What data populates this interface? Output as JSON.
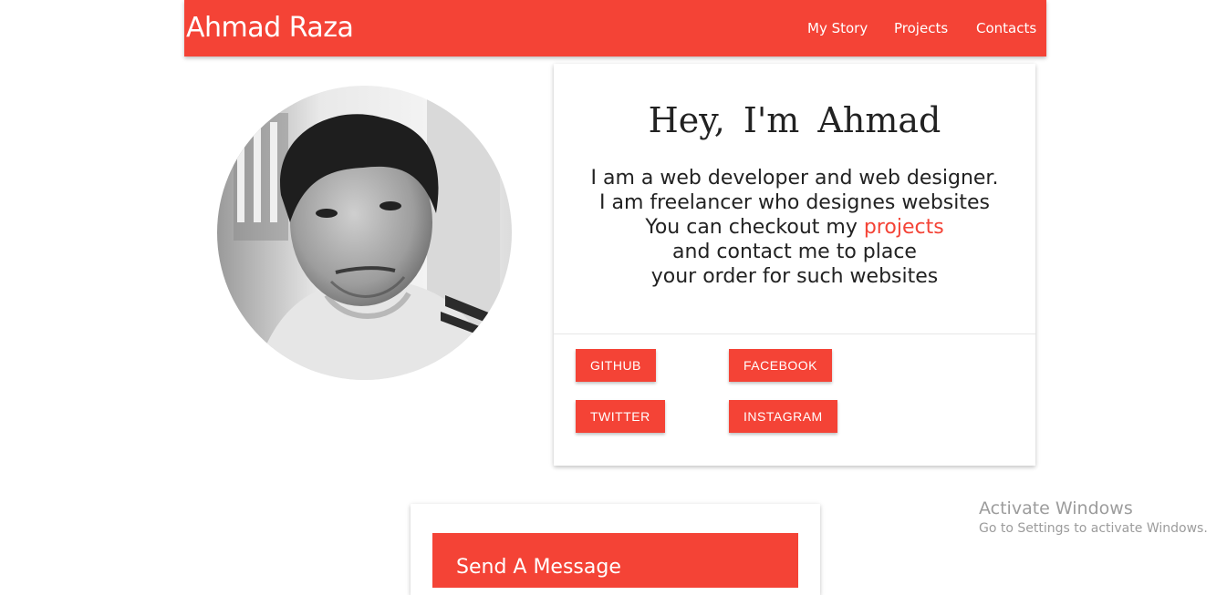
{
  "navbar": {
    "brand": "Ahmad Raza",
    "links": [
      "My Story",
      "Projects",
      "Contacts"
    ],
    "color": "#f44336"
  },
  "profile": {
    "photo_alt": "profile photo"
  },
  "intro": {
    "title": "Hey,  I'm Ahmad",
    "lines": [
      "I am a web developer and web designer.",
      "I am freelancer who designes websites",
      "You can checkout my",
      "and contact me to place",
      "your order for such websites"
    ],
    "projects_link": "projects"
  },
  "social_buttons": [
    "GITHUB",
    "FACEBOOK",
    "TWITTER",
    "INSTAGRAM"
  ],
  "message_card": {
    "title": "Send A Message"
  },
  "watermark": {
    "title": "Activate Windows",
    "subtitle": "Go to Settings to activate Windows."
  }
}
